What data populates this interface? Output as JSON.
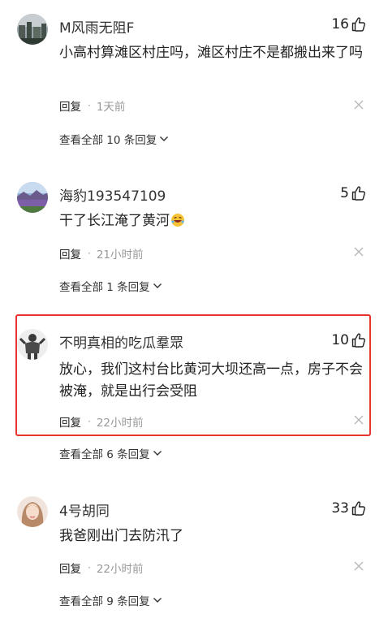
{
  "comments": [
    {
      "username": "M风雨无阻F",
      "likes": "16",
      "text": "小高村算滩区村庄吗，滩区村庄不是都搬出来了吗",
      "reply_label": "回复",
      "separator": "·",
      "time": "1天前",
      "view_all": "查看全部 10 条回复"
    },
    {
      "username": "海豹193547109",
      "likes": "5",
      "text": "干了长江淹了黄河",
      "reply_label": "回复",
      "separator": "·",
      "time": "21小时前",
      "view_all": "查看全部 1 条回复"
    },
    {
      "username": "不明真相的吃瓜羣眾",
      "likes": "10",
      "text": "放心，我们这村台比黄河大坝还高一点，房子不会被淹，就是出行会受阻",
      "reply_label": "回复",
      "separator": "·",
      "time": "22小时前",
      "view_all": "查看全部 6 条回复"
    },
    {
      "username": "4号胡同",
      "likes": "33",
      "text": "我爸刚出门去防汛了",
      "reply_label": "回复",
      "separator": "·",
      "time": "22小时前",
      "view_all": "查看全部 9 条回复"
    }
  ],
  "icons": {
    "like": "thumbs-up-icon",
    "close": "close-icon",
    "expand": "chevron-down-icon",
    "emoji": "rofl-emoji-icon"
  },
  "colors": {
    "highlight_border": "#e8332f",
    "secondary_text": "#999999"
  }
}
